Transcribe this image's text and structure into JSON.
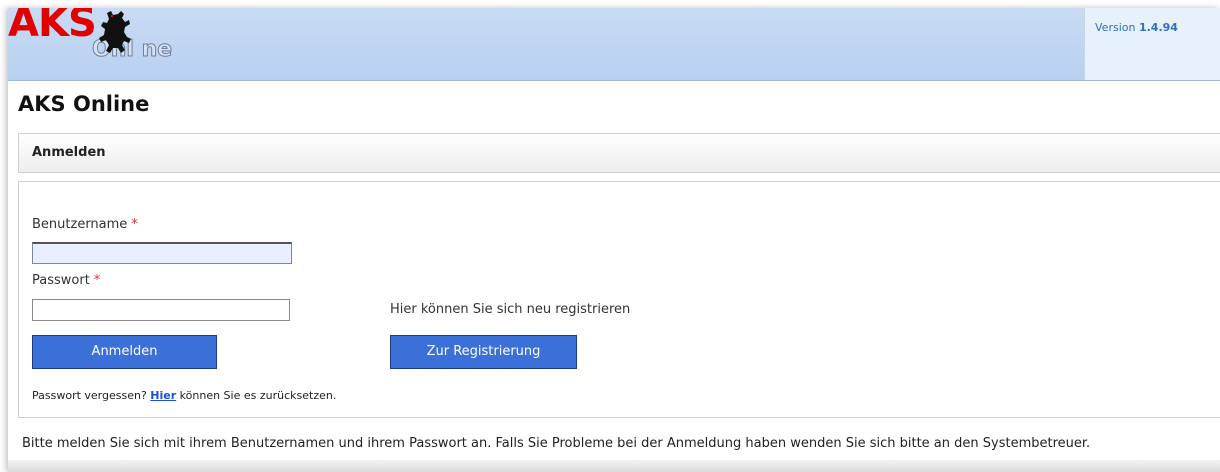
{
  "header": {
    "logo_main": "AKS",
    "logo_sub": "Onl  ne",
    "version_prefix": "Version",
    "version_number": "1.4.94"
  },
  "page": {
    "title": "AKS Online"
  },
  "login_panel": {
    "header": "Anmelden",
    "username_label": "Benutzername",
    "password_label": "Passwort",
    "required_marker": "*",
    "username_value": "",
    "password_value": "",
    "login_button": "Anmelden",
    "register_text": "Hier können Sie sich neu registrieren",
    "register_button": "Zur Registrierung",
    "forgot_prefix": "Passwort vergessen?",
    "forgot_link": "Hier",
    "forgot_suffix": "können Sie es zurücksetzen."
  },
  "footer": {
    "info": "Bitte melden Sie sich mit ihrem Benutzernamen und ihrem Passwort an. Falls Sie Probleme bei der Anmeldung haben wenden Sie sich bitte an den Systembetreuer."
  },
  "icons": {
    "logo": "berlin-bear-icon"
  },
  "colors": {
    "banner": "#c3d6f2",
    "logo_red": "#e00000",
    "button_blue": "#3b70d9",
    "link_blue": "#1a4fd6",
    "required_red": "#e03030"
  }
}
